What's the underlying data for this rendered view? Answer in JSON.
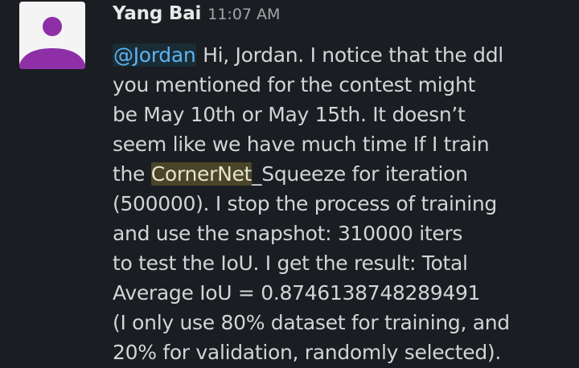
{
  "message": {
    "sender": "Yang Bai",
    "timestamp": "11:07 AM",
    "lines": [
      {
        "mention": "@Jordan",
        "text": " Hi, Jordan. I notice that the ddl"
      },
      {
        "text": "you mentioned for the contest might"
      },
      {
        "text": "be May 10th or May 15th. It doesn’t"
      },
      {
        "text": "seem like we have much time If I train"
      },
      {
        "pre": "the ",
        "highlight": "CornerNet",
        "post": "_Squeeze for iteration"
      },
      {
        "text": "(500000). I stop the process of training"
      },
      {
        "text": "and use the snapshot: 310000 iters"
      },
      {
        "text": "to test the IoU. I get the result: Total"
      },
      {
        "text": "Average IoU =  0.8746138748289491"
      },
      {
        "text": "(I only use 80% dataset for training, and"
      },
      {
        "text": "20% for validation, randomly selected)."
      }
    ]
  },
  "colors": {
    "background": "#1a1d21",
    "avatar_bg": "#f4f4f4",
    "avatar_figure": "#8e2fa8",
    "mention": "#5db3ef",
    "highlight_bg": "#4a4528",
    "text": "#d3d4d6"
  },
  "icons": {
    "avatar": "default-user-avatar-icon"
  }
}
